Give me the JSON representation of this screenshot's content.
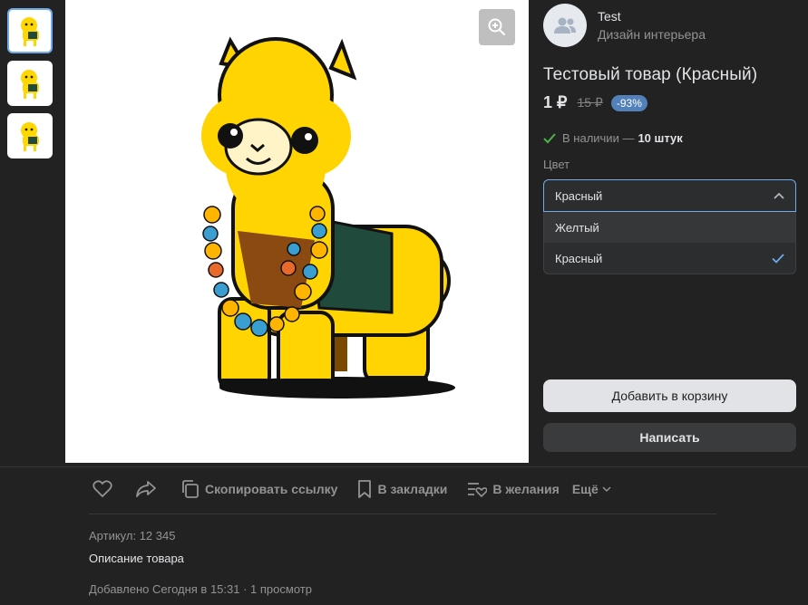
{
  "seller": {
    "name": "Test",
    "subtitle": "Дизайн интерьера"
  },
  "product": {
    "title": "Тестовый товар (Красный)",
    "price": "1 ₽",
    "old_price": "15 ₽",
    "discount": "-93%",
    "stock_text": "В наличии —",
    "stock_count": "10 штук"
  },
  "color": {
    "label": "Цвет",
    "selected": "Красный",
    "options": [
      "Желтый",
      "Красный"
    ]
  },
  "buttons": {
    "add_to_cart": "Добавить в корзину",
    "write": "Написать"
  },
  "actions": {
    "copy_link": "Скопировать ссылку",
    "bookmarks": "В закладки",
    "wishlist": "В желания",
    "more": "Ещё"
  },
  "meta": {
    "article": "Артикул: 12 345",
    "description": "Описание товара",
    "added": "Добавлено Сегодня в 15:31 · 1 просмотр"
  },
  "colors": {
    "accent": "#71aaeb",
    "discount_bg": "#5181b8",
    "check": "#4bb34b",
    "background": "#222222"
  },
  "icons": [
    "zoom-in-icon",
    "users-icon",
    "check-icon",
    "chevron-up-icon",
    "heart-icon",
    "share-icon",
    "copy-icon",
    "bookmark-icon",
    "wishlist-icon",
    "chevron-down-icon"
  ]
}
